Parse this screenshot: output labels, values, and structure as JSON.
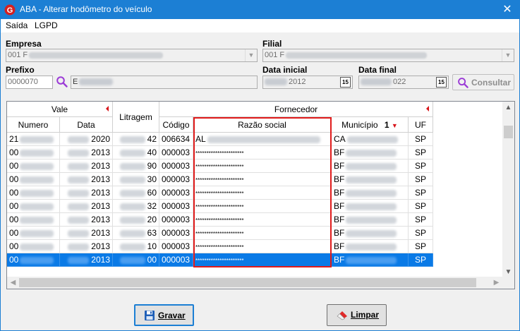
{
  "window": {
    "title": "ABA - Alterar hodômetro do veículo",
    "close_glyph": "✕"
  },
  "menu": [
    "Saída",
    "LGPD"
  ],
  "form": {
    "empresa_label": "Empresa",
    "empresa_value": "001 F",
    "filial_label": "Filial",
    "filial_value": "001 F",
    "prefixo_label": "Prefixo",
    "prefixo_value": "0000070",
    "prefixo_desc": "E",
    "data_inicial_label": "Data inicial",
    "data_inicial_value": "2012",
    "data_final_label": "Data final",
    "data_final_value": "022",
    "cal_icon_text": "15",
    "consultar_label": "Consultar"
  },
  "grid": {
    "group_vale": "Vale",
    "group_fornecedor": "Fornecedor",
    "columns": {
      "numero": "Numero",
      "data": "Data",
      "litragem": "Litragem",
      "codigo": "Código",
      "razao": "Razão social",
      "municipio": "Município",
      "municipio_sort": "1",
      "uf": "UF"
    },
    "rows": [
      {
        "numero": "21",
        "data": "2020",
        "litragem": "42",
        "codigo": "006634",
        "razao": "AL",
        "municipio": "CA",
        "uf": "SP",
        "selected": false
      },
      {
        "numero": "00",
        "data": "2013",
        "litragem": "40",
        "codigo": "000003",
        "razao": "**********************",
        "municipio": "BF",
        "uf": "SP",
        "selected": false
      },
      {
        "numero": "00",
        "data": "2013",
        "litragem": "90",
        "codigo": "000003",
        "razao": "**********************",
        "municipio": "BF",
        "uf": "SP",
        "selected": false
      },
      {
        "numero": "00",
        "data": "2013",
        "litragem": "30",
        "codigo": "000003",
        "razao": "**********************",
        "municipio": "BF",
        "uf": "SP",
        "selected": false
      },
      {
        "numero": "00",
        "data": "2013",
        "litragem": "60",
        "codigo": "000003",
        "razao": "**********************",
        "municipio": "BF",
        "uf": "SP",
        "selected": false
      },
      {
        "numero": "00",
        "data": "2013",
        "litragem": "32",
        "codigo": "000003",
        "razao": "**********************",
        "municipio": "BF",
        "uf": "SP",
        "selected": false
      },
      {
        "numero": "00",
        "data": "2013",
        "litragem": "20",
        "codigo": "000003",
        "razao": "**********************",
        "municipio": "BF",
        "uf": "SP",
        "selected": false
      },
      {
        "numero": "00",
        "data": "2013",
        "litragem": "63",
        "codigo": "000003",
        "razao": "**********************",
        "municipio": "BF",
        "uf": "SP",
        "selected": false
      },
      {
        "numero": "00",
        "data": "2013",
        "litragem": "10",
        "codigo": "000003",
        "razao": "**********************",
        "municipio": "BF",
        "uf": "SP",
        "selected": false
      },
      {
        "numero": "00",
        "data": "2013",
        "litragem": "00",
        "codigo": "000003",
        "razao": "**********************",
        "municipio": "BF",
        "uf": "SP",
        "selected": true
      }
    ]
  },
  "buttons": {
    "gravar": "Gravar",
    "limpar": "Limpar"
  },
  "colors": {
    "titlebar": "#1c7fd4",
    "selection": "#0a7ae6",
    "highlight_box": "#e01b1b",
    "sort_arrow": "#d8141a"
  }
}
